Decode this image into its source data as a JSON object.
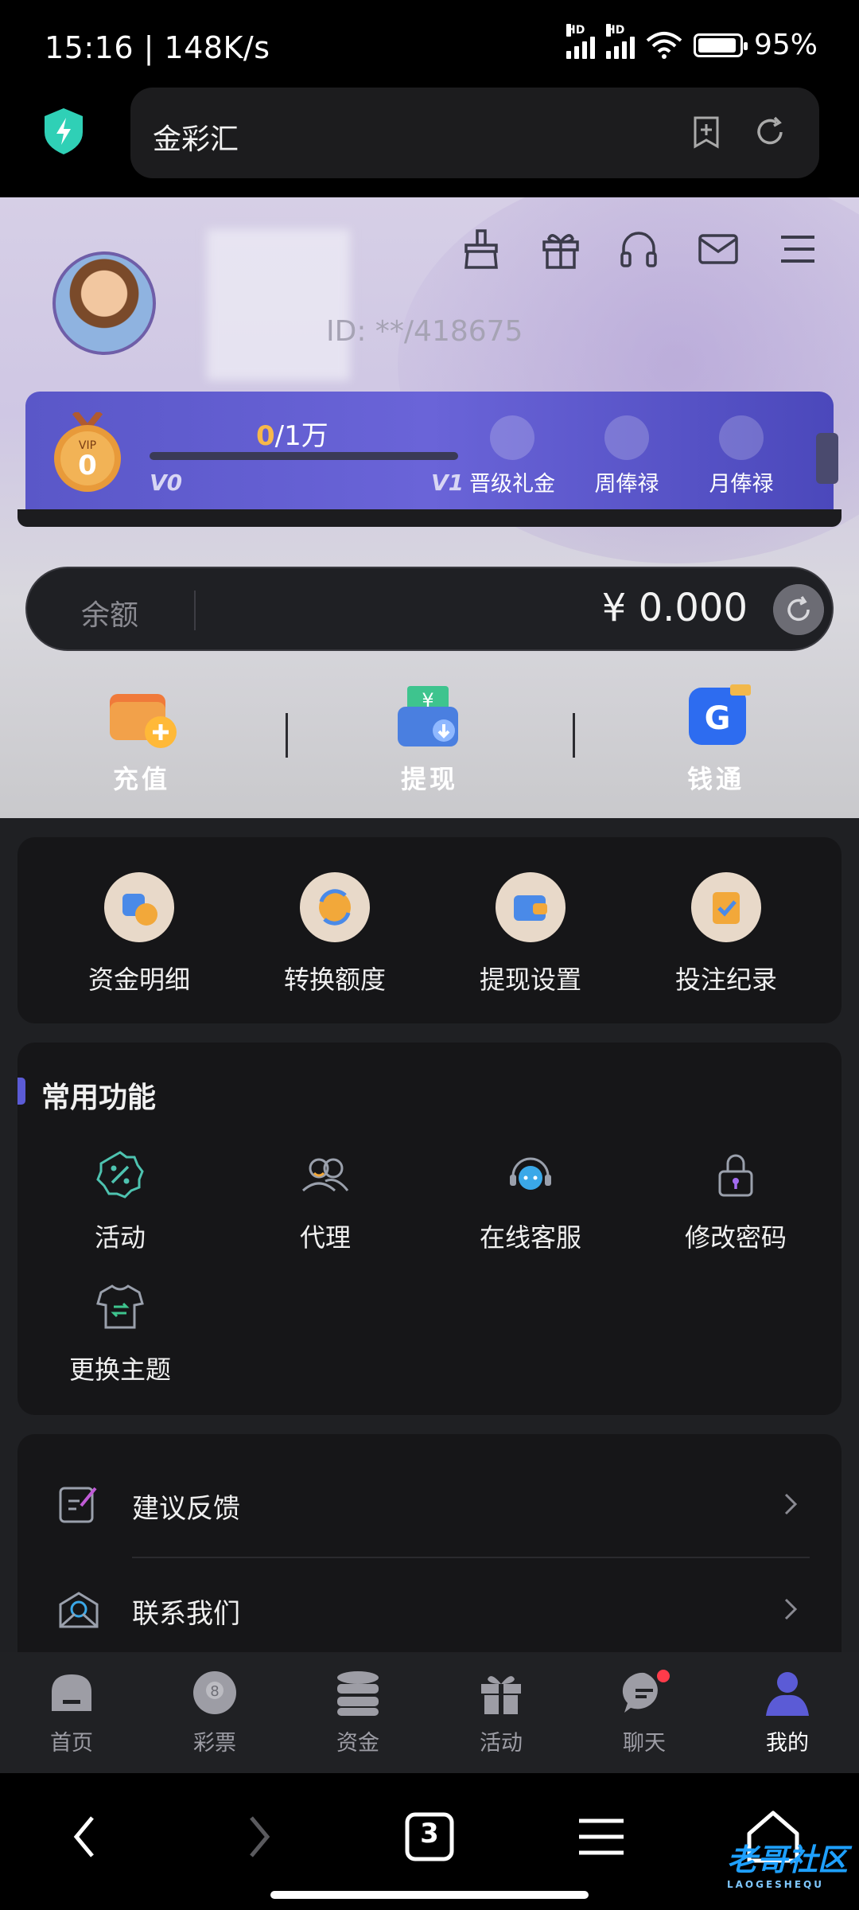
{
  "status_bar": {
    "time": "15:16 | 148K/s",
    "battery": "95%",
    "sim1_label": "HD",
    "sim2_label": "HD"
  },
  "browser": {
    "page_title": "金彩汇",
    "tab_count": "3"
  },
  "profile": {
    "user_id": "ID: **/418675"
  },
  "vip": {
    "badge_label": "VIP",
    "level": "0",
    "progress_current": "0",
    "progress_target": "/1万",
    "progress_fraction": 0,
    "from_level": "V0",
    "to_level": "V1",
    "perks": [
      "晋级礼金",
      "周俸禄",
      "月俸禄"
    ]
  },
  "balance": {
    "label": "余额",
    "amount": "¥ 0.000"
  },
  "quick_actions": [
    "充值",
    "提现",
    "钱通"
  ],
  "finance_grid": [
    "资金明细",
    "转换额度",
    "提现设置",
    "投注纪录"
  ],
  "common": {
    "title": "常用功能",
    "items": [
      "活动",
      "代理",
      "在线客服",
      "修改密码",
      "更换主题"
    ]
  },
  "list": [
    "建议反馈",
    "联系我们"
  ],
  "tabs": [
    "首页",
    "彩票",
    "资金",
    "活动",
    "聊天",
    "我的"
  ],
  "watermark": {
    "text": "老哥社区",
    "sub": "LAOGESHEQU"
  },
  "colors": {
    "accent": "#5b5bd6",
    "gold": "#f7b84a",
    "badge": "#ff3b4a"
  }
}
